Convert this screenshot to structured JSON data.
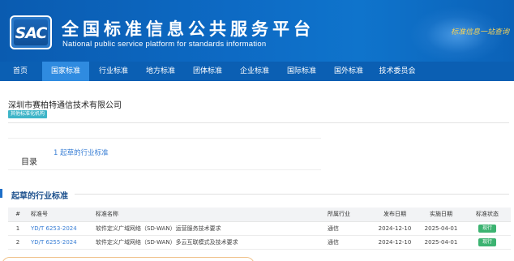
{
  "header": {
    "logo_text": "SAC",
    "title_cn": "全国标准信息公共服务平台",
    "title_en": "National public service platform  for standards information",
    "slogan": "标准信息一站查询"
  },
  "nav": {
    "items": [
      "首页",
      "国家标准",
      "行业标准",
      "地方标准",
      "团体标准",
      "企业标准",
      "国际标准",
      "国外标准",
      "技术委员会"
    ],
    "active_index": 1
  },
  "org": {
    "name": "深圳市赛柏特通信技术有限公司",
    "tag": "其他标准化机构"
  },
  "toc": {
    "label": "目录",
    "link": "1 起草的行业标准"
  },
  "section": {
    "title": "起草的行业标准"
  },
  "table": {
    "headers": [
      "#",
      "标准号",
      "标准名称",
      "所属行业",
      "发布日期",
      "实施日期",
      "标准状态"
    ],
    "rows": [
      {
        "num": "1",
        "code": "YD/T 6253-2024",
        "name": "软件定义广域网络（SD-WAN）运营服务技术要求",
        "industry": "通信",
        "published": "2024-12-10",
        "effective": "2025-04-01",
        "status": "现行"
      },
      {
        "num": "2",
        "code": "YD/T 6255-2024",
        "name": "软件定义广域网络（SD-WAN）多云互联模式及技术要求",
        "industry": "通信",
        "published": "2024-12-10",
        "effective": "2025-04-01",
        "status": "现行"
      }
    ]
  },
  "colors": {
    "banner": "#0d6ac4",
    "nav": "#0b5fb3",
    "nav_active": "#2f8be0",
    "link": "#3a7fd5",
    "tag": "#3eb5c8",
    "status": "#3cb371"
  }
}
